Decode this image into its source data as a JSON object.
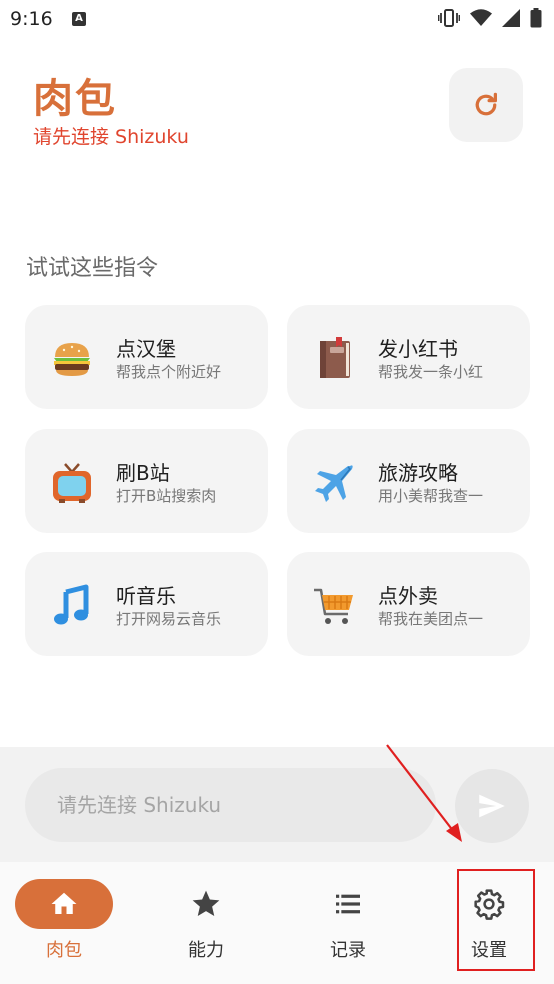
{
  "status_bar": {
    "time": "9:16",
    "app_icon_letter": "A"
  },
  "header": {
    "title": "肉包",
    "subtitle": "请先连接 Shizuku"
  },
  "suggestions": {
    "heading": "试试这些指令",
    "cards": [
      {
        "title": "点汉堡",
        "desc": "帮我点个附近好",
        "icon": "burger-icon"
      },
      {
        "title": "发小红书",
        "desc": "帮我发一条小红",
        "icon": "book-icon"
      },
      {
        "title": "刷B站",
        "desc": "打开B站搜索肉",
        "icon": "tv-icon"
      },
      {
        "title": "旅游攻略",
        "desc": "用小美帮我查一",
        "icon": "airplane-icon"
      },
      {
        "title": "听音乐",
        "desc": "打开网易云音乐",
        "icon": "music-note-icon"
      },
      {
        "title": "点外卖",
        "desc": "帮我在美团点一",
        "icon": "shopping-cart-icon"
      }
    ]
  },
  "input": {
    "placeholder": "请先连接 Shizuku"
  },
  "nav": {
    "items": [
      {
        "label": "肉包",
        "icon": "home-icon",
        "active": true
      },
      {
        "label": "能力",
        "icon": "star-icon",
        "active": false
      },
      {
        "label": "记录",
        "icon": "list-icon",
        "active": false
      },
      {
        "label": "设置",
        "icon": "gear-icon",
        "active": false
      }
    ]
  },
  "colors": {
    "accent": "#d8703a",
    "warning": "#e0452e",
    "annotation": "#e02020"
  }
}
